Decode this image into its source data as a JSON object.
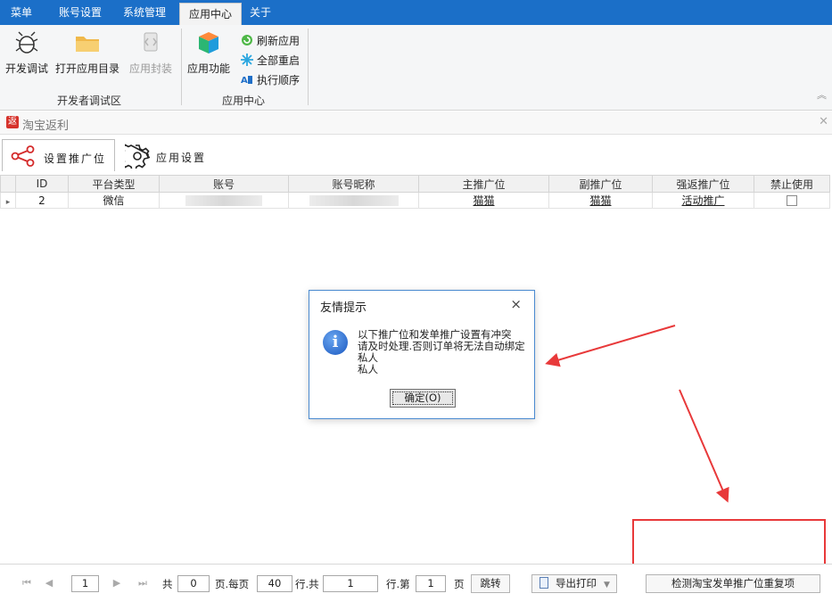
{
  "menubar": {
    "items": [
      "菜单",
      "账号设置",
      "系统管理",
      "应用中心",
      "关于"
    ],
    "active_index": 3
  },
  "ribbon": {
    "dev_group": {
      "label": "开发者调试区",
      "buttons": [
        "开发调试",
        "打开应用目录",
        "应用封装"
      ]
    },
    "app_group": {
      "label": "应用中心",
      "main_button": "应用功能",
      "small_buttons": [
        "刷新应用",
        "全部重启",
        "执行顺序"
      ]
    }
  },
  "doc_tab": {
    "badge": "返",
    "title": "淘宝返利"
  },
  "subtabs": [
    "设置推广位",
    "应用设置"
  ],
  "grid": {
    "columns": [
      "ID",
      "平台类型",
      "账号",
      "账号昵称",
      "主推广位",
      "副推广位",
      "强返推广位",
      "禁止使用"
    ],
    "rows": [
      {
        "id": "2",
        "platform": "微信",
        "main": "猫猫",
        "secondary": "猫猫",
        "strong": "活动推广"
      }
    ]
  },
  "dialog": {
    "title": "友情提示",
    "close": "×",
    "lines": [
      "以下推广位和发单推广设置有冲突",
      "请及时处理.否则订单将无法自动绑定",
      "私人",
      "私人"
    ],
    "ok": "确定(O)"
  },
  "pager": {
    "page": "1",
    "total_label": "共",
    "total_pages": "0",
    "per_page_label": "页.每页",
    "per_page": "40",
    "rows_total_label": "行.共",
    "rows_total": "1",
    "row_label": "行.第",
    "current": "1",
    "page_label": "页",
    "jump": "跳转",
    "export": "导出打印",
    "check_button": "检测淘宝发单推广位重复项"
  },
  "colors": {
    "menubar": "#1b6fc8",
    "annotation_red": "#e8393a",
    "dialog_border": "#4a8ad0"
  }
}
